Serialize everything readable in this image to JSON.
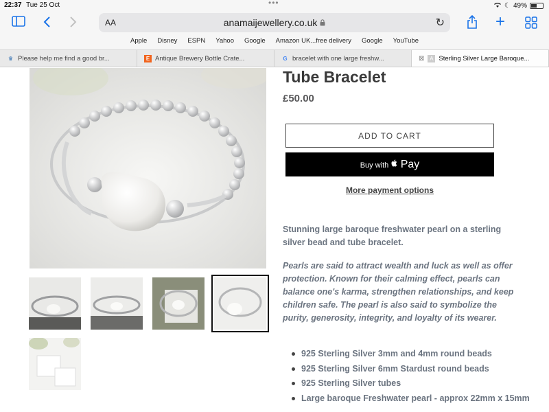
{
  "status_bar": {
    "time": "22:37",
    "date": "Tue 25 Oct",
    "battery": "49%"
  },
  "toolbar": {
    "text_size_label": "AA",
    "url": "anamaijewellery.co.uk",
    "icons": [
      "sidebar-icon",
      "back-icon",
      "forward-icon",
      "lock-icon",
      "reload-icon",
      "share-icon",
      "new-tab-icon",
      "tab-overview-icon"
    ]
  },
  "favorites": [
    "Apple",
    "Disney",
    "ESPN",
    "Yahoo",
    "Google",
    "Amazon UK...free delivery",
    "Google",
    "YouTube"
  ],
  "tabs": [
    {
      "title": "Please help me find a good br...",
      "favicon": "crown-icon"
    },
    {
      "title": "Antique Brewery Bottle Crate...",
      "favicon": "etsy-icon"
    },
    {
      "title": "bracelet with one large freshw...",
      "favicon": "google-icon"
    },
    {
      "title": "Sterling Silver Large Baroque...",
      "favicon": "site-icon",
      "active": true
    }
  ],
  "product": {
    "title": "Tube Bracelet",
    "price": "£50.00",
    "add_to_cart": "ADD TO CART",
    "buy_with": "Buy with",
    "apple_pay": "Pay",
    "more_payment_options": "More payment options",
    "description_1": "Stunning large baroque freshwater pearl on a sterling silver bead and tube bracelet.",
    "description_2": "Pearls are said to attract wealth and luck as well as offer protection.    Known for their calming effect, pearls can balance one's karma, strengthen relationships, and keep children safe. The pearl is also said to symbolize the purity, generosity, integrity, and loyalty of its wearer.",
    "features": [
      "925 Sterling Silver 3mm and 4mm round beads",
      "925 Sterling Silver 6mm Stardust round beads",
      "925 Sterling Silver tubes",
      "Large baroque Freshwater pearl - approx 22mm x 15mm"
    ]
  },
  "colors": {
    "link": "#1a73e8",
    "text": "#6b7480",
    "button_dark": "#000000"
  }
}
